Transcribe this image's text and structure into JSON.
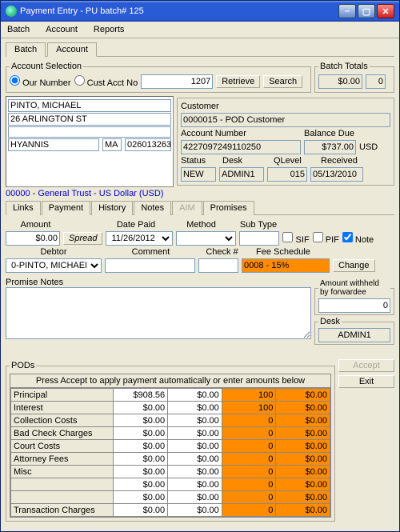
{
  "window_title": "Payment Entry - PU batch# 125",
  "menu": [
    "Batch",
    "Account",
    "Reports"
  ],
  "main_tabs": [
    "Batch",
    "Account"
  ],
  "account_selection": {
    "legend": "Account Selection",
    "our_number": "Our Number",
    "cust_acct_no": "Cust Acct No",
    "value": "1207",
    "retrieve": "Retrieve",
    "search": "Search"
  },
  "batch_totals": {
    "legend": "Batch Totals",
    "amount": "$0.00",
    "count": "0"
  },
  "debtor_addr": {
    "name": "PINTO, MICHAEL",
    "street": "26 ARLINGTON ST",
    "city": "HYANNIS",
    "state": "MA",
    "zip": "026013263"
  },
  "customer": {
    "label": "Customer",
    "value": "0000015 - POD Customer"
  },
  "accountnum": {
    "label": "Account Number",
    "value": "4227097249110250"
  },
  "balance": {
    "label": "Balance Due",
    "value": "$737.00",
    "cur": "USD"
  },
  "status_row": {
    "status_l": "Status",
    "status_v": "NEW",
    "desk_l": "Desk",
    "desk_v": "ADMIN1",
    "qlevel_l": "QLevel",
    "qlevel_v": "015",
    "received_l": "Received",
    "received_v": "05/13/2010"
  },
  "trust_line": "00000 - General Trust - US Dollar (USD)",
  "subtabs": [
    "Links",
    "Payment",
    "History",
    "Notes",
    "AIM",
    "Promises"
  ],
  "payrow": {
    "amount_l": "Amount",
    "amount_v": "$0.00",
    "spread": "Spread",
    "datepaid_l": "Date Paid",
    "datepaid_v": "11/26/2012",
    "method_l": "Method",
    "subtype_l": "Sub Type",
    "sif": "SIF",
    "pif": "PIF",
    "note": "Note"
  },
  "row2": {
    "debtor_l": "Debtor",
    "debtor_v": "0-PINTO, MICHAEL",
    "comment_l": "Comment",
    "check_l": "Check #",
    "fee_l": "Fee Schedule",
    "fee_v": "0008 - 15%",
    "change": "Change"
  },
  "promise_notes_l": "Promise Notes",
  "withheld": {
    "legend": "Amount withheld by forwardee",
    "value": "0"
  },
  "desk_box": {
    "legend": "Desk",
    "value": "ADMIN1"
  },
  "pods": {
    "legend": "PODs",
    "header": "Press Accept to apply payment automatically or enter amounts below",
    "rows": [
      {
        "label": "Principal",
        "c1": "$908.56",
        "c2": "$0.00",
        "c3": "100",
        "c4": "$0.00"
      },
      {
        "label": "Interest",
        "c1": "$0.00",
        "c2": "$0.00",
        "c3": "100",
        "c4": "$0.00"
      },
      {
        "label": "Collection Costs",
        "c1": "$0.00",
        "c2": "$0.00",
        "c3": "0",
        "c4": "$0.00"
      },
      {
        "label": "Bad Check Charges",
        "c1": "$0.00",
        "c2": "$0.00",
        "c3": "0",
        "c4": "$0.00"
      },
      {
        "label": "Court Costs",
        "c1": "$0.00",
        "c2": "$0.00",
        "c3": "0",
        "c4": "$0.00"
      },
      {
        "label": "Attorney Fees",
        "c1": "$0.00",
        "c2": "$0.00",
        "c3": "0",
        "c4": "$0.00"
      },
      {
        "label": "Misc",
        "c1": "$0.00",
        "c2": "$0.00",
        "c3": "0",
        "c4": "$0.00"
      },
      {
        "label": "",
        "c1": "$0.00",
        "c2": "$0.00",
        "c3": "0",
        "c4": "$0.00"
      },
      {
        "label": "",
        "c1": "$0.00",
        "c2": "$0.00",
        "c3": "0",
        "c4": "$0.00"
      },
      {
        "label": "Transaction Charges",
        "c1": "$0.00",
        "c2": "$0.00",
        "c3": "0",
        "c4": "$0.00"
      }
    ]
  },
  "accept": "Accept",
  "exit": "Exit"
}
